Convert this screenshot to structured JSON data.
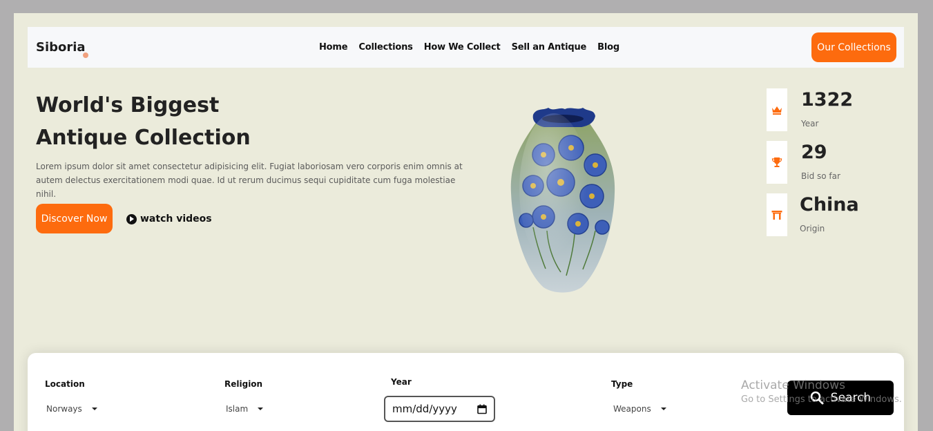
{
  "nav": {
    "brand": "Siboria",
    "links": [
      "Home",
      "Collections",
      "How We Collect",
      "Sell an Antique",
      "Blog"
    ],
    "cta_label": "Our Collections"
  },
  "hero": {
    "title_line1": "World's Biggest",
    "title_line2": "Antique Collection",
    "description": "Lorem ipsum dolor sit amet consectetur adipisicing elit. Fugiat laboriosam vero corporis enim omnis at autem delectus exercitationem modi quae. Id ut rerum ducimus sequi cupiditate cum fuga molestiae nihil.",
    "discover_label": "Discover Now",
    "watch_label": "watch videos"
  },
  "stats": [
    {
      "value": "1322",
      "label": "Year",
      "icon": "crown-icon"
    },
    {
      "value": "29",
      "label": "Bid so far",
      "icon": "trophy-icon"
    },
    {
      "value": "China",
      "label": "Origin",
      "icon": "gate-icon"
    }
  ],
  "search": {
    "location_label": "Location",
    "location_value": "Norways",
    "religion_label": "Religion",
    "religion_value": "Islam",
    "year_label": "Year",
    "year_placeholder": "mm/dd/yyyy",
    "type_label": "Type",
    "type_value": "Weapons",
    "search_label": "Search"
  },
  "watermark": {
    "title": "Activate Windows",
    "subtitle": "Go to Settings to activate Windows."
  },
  "colors": {
    "accent": "#fd6b0e",
    "page_bg": "#ebebdb",
    "outer_bg": "#b0afb0"
  }
}
